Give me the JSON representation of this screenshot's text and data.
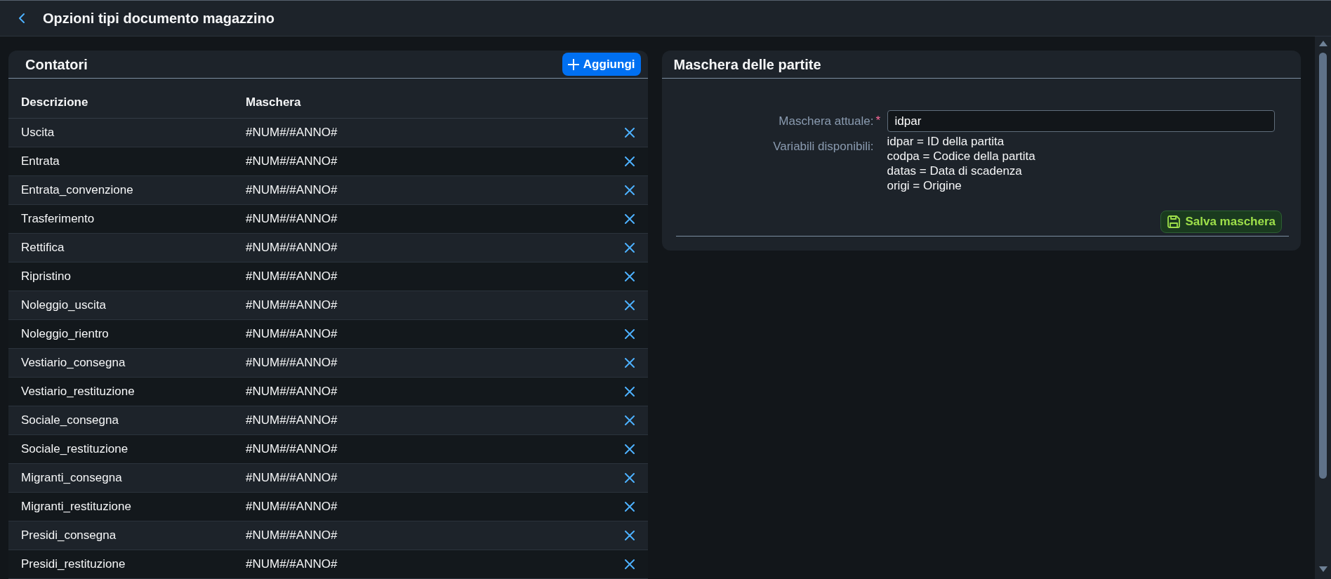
{
  "header": {
    "title": "Opzioni tipi documento magazzino"
  },
  "counters": {
    "title": "Contatori",
    "add_button": "Aggiungi",
    "columns": [
      "Descrizione",
      "Maschera"
    ],
    "rows": [
      {
        "description": "Uscita",
        "mask": "#NUM#/#ANNO#"
      },
      {
        "description": "Entrata",
        "mask": "#NUM#/#ANNO#"
      },
      {
        "description": "Entrata_convenzione",
        "mask": "#NUM#/#ANNO#"
      },
      {
        "description": "Trasferimento",
        "mask": "#NUM#/#ANNO#"
      },
      {
        "description": "Rettifica",
        "mask": "#NUM#/#ANNO#"
      },
      {
        "description": "Ripristino",
        "mask": "#NUM#/#ANNO#"
      },
      {
        "description": "Noleggio_uscita",
        "mask": "#NUM#/#ANNO#"
      },
      {
        "description": "Noleggio_rientro",
        "mask": "#NUM#/#ANNO#"
      },
      {
        "description": "Vestiario_consegna",
        "mask": "#NUM#/#ANNO#"
      },
      {
        "description": "Vestiario_restituzione",
        "mask": "#NUM#/#ANNO#"
      },
      {
        "description": "Sociale_consegna",
        "mask": "#NUM#/#ANNO#"
      },
      {
        "description": "Sociale_restituzione",
        "mask": "#NUM#/#ANNO#"
      },
      {
        "description": "Migranti_consegna",
        "mask": "#NUM#/#ANNO#"
      },
      {
        "description": "Migranti_restituzione",
        "mask": "#NUM#/#ANNO#"
      },
      {
        "description": "Presidi_consegna",
        "mask": "#NUM#/#ANNO#"
      },
      {
        "description": "Presidi_restituzione",
        "mask": "#NUM#/#ANNO#"
      }
    ]
  },
  "batch_mask": {
    "title": "Maschera delle partite",
    "current_mask": {
      "label": "Maschera attuale:",
      "required_mark": "*",
      "value": "idpar"
    },
    "variables": {
      "label": "Variabili disponibili:",
      "lines": [
        "idpar = ID della partita",
        "codpa = Codice della partita",
        "datas = Data di scadenza",
        "origi = Origine"
      ]
    },
    "save_button": "Salva maschera"
  }
}
